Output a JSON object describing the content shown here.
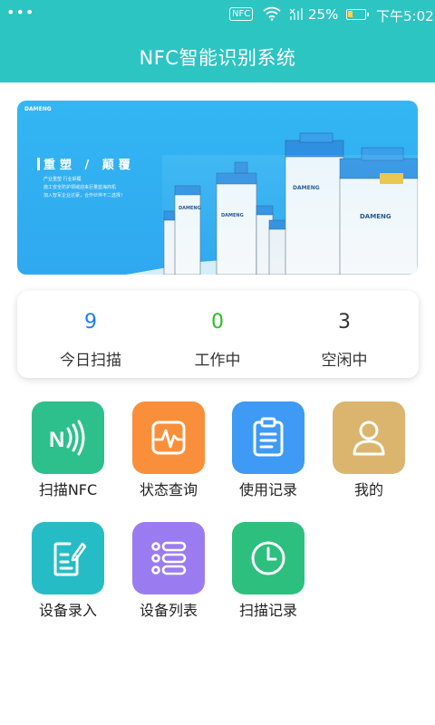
{
  "status_bar": {
    "dots": "•••",
    "nfc": "NFC",
    "battery": "25%",
    "time": "下午5:02"
  },
  "header": {
    "title": "NFC智能识别系统"
  },
  "banner": {
    "brand": "DAMENG",
    "slogan_title": "重塑 / 颠覆",
    "lines": [
      "产业重塑 行业颠覆",
      "施工安全防护领域迎来巨量蓝海商机",
      "加入智军企业达豪，合作伙伴不二选择！"
    ],
    "building_labels": [
      "DAMENG",
      "DAMENG",
      "DAMENG"
    ]
  },
  "stats": [
    {
      "value": "9",
      "label": "今日扫描",
      "color": "#1e7ef0"
    },
    {
      "value": "0",
      "label": "工作中",
      "color": "#27c024"
    },
    {
      "value": "3",
      "label": "空闲中",
      "color": "#333333"
    }
  ],
  "menu": [
    {
      "label": "扫描NFC",
      "icon": "nfc-icon",
      "color": "#2dc08d"
    },
    {
      "label": "状态查询",
      "icon": "waveform-icon",
      "color": "#f98f3a"
    },
    {
      "label": "使用记录",
      "icon": "clipboard-icon",
      "color": "#3e9af5"
    },
    {
      "label": "我的",
      "icon": "user-icon",
      "color": "#dbb56d"
    },
    {
      "label": "设备录入",
      "icon": "edit-document-icon",
      "color": "#26bcc6"
    },
    {
      "label": "设备列表",
      "icon": "list-icon",
      "color": "#9b7cf0"
    },
    {
      "label": "扫描记录",
      "icon": "clock-icon",
      "color": "#2dbf7e"
    }
  ]
}
